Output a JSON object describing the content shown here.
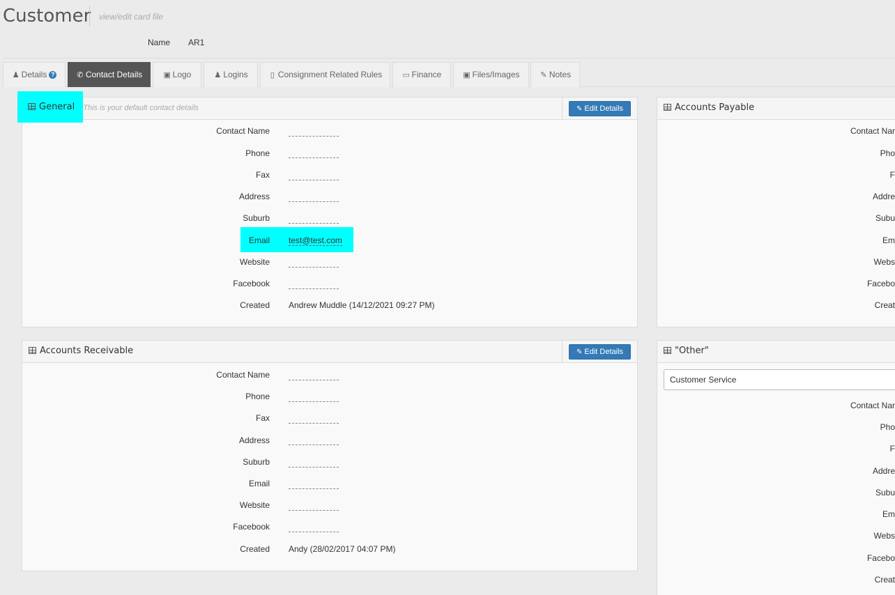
{
  "page": {
    "title": "Customer",
    "subtitle": "view/edit card file",
    "name_label": "Name",
    "name_value": "AR1"
  },
  "tabs": [
    {
      "label": "Details",
      "icon": "user-icon"
    },
    {
      "label": "Contact Details",
      "icon": "phone-icon"
    },
    {
      "label": "Logo",
      "icon": "image-icon"
    },
    {
      "label": "Logins",
      "icon": "users-icon"
    },
    {
      "label": "Consignment Related Rules",
      "icon": "file-icon"
    },
    {
      "label": "Finance",
      "icon": "folder-open-icon"
    },
    {
      "label": "Files/Images",
      "icon": "file-image-icon"
    },
    {
      "label": "Notes",
      "icon": "pencil-icon"
    }
  ],
  "active_tab": "Contact Details",
  "labels": {
    "contact_name": "Contact Name",
    "phone": "Phone",
    "fax": "Fax",
    "address": "Address",
    "suburb": "Suburb",
    "email": "Email",
    "website": "Website",
    "facebook": "Facebook",
    "created": "Created"
  },
  "edit_button_label": "Edit Details",
  "general": {
    "title": "General",
    "description": "- This is your default contact details",
    "email": "test@test.com",
    "created": "Andrew Muddle (14/12/2021 09:27 PM)"
  },
  "accounts_receivable": {
    "title": "Accounts Receivable",
    "created": "Andy (28/02/2017 04:07 PM)"
  },
  "accounts_payable": {
    "title": "Accounts Payable",
    "labels_clipped": {
      "contact_name": "Contact Nar",
      "phone": "Pho",
      "fax": "F",
      "address": "Addre",
      "suburb": "Subu",
      "email": "Em",
      "website": "Webs",
      "facebook": "Facebo",
      "created": "Creat"
    }
  },
  "other": {
    "title": "\"Other\"",
    "select_value": "Customer Service",
    "labels_clipped": {
      "contact_name": "Contact Nar",
      "phone": "Pho",
      "fax": "F",
      "address": "Addre",
      "suburb": "Subu",
      "email": "Em",
      "website": "Webs",
      "facebook": "Facebo",
      "created": "Creat"
    }
  },
  "colors": {
    "highlight": "#00ffff",
    "active_tab": "#555555",
    "button": "#337ab7"
  }
}
